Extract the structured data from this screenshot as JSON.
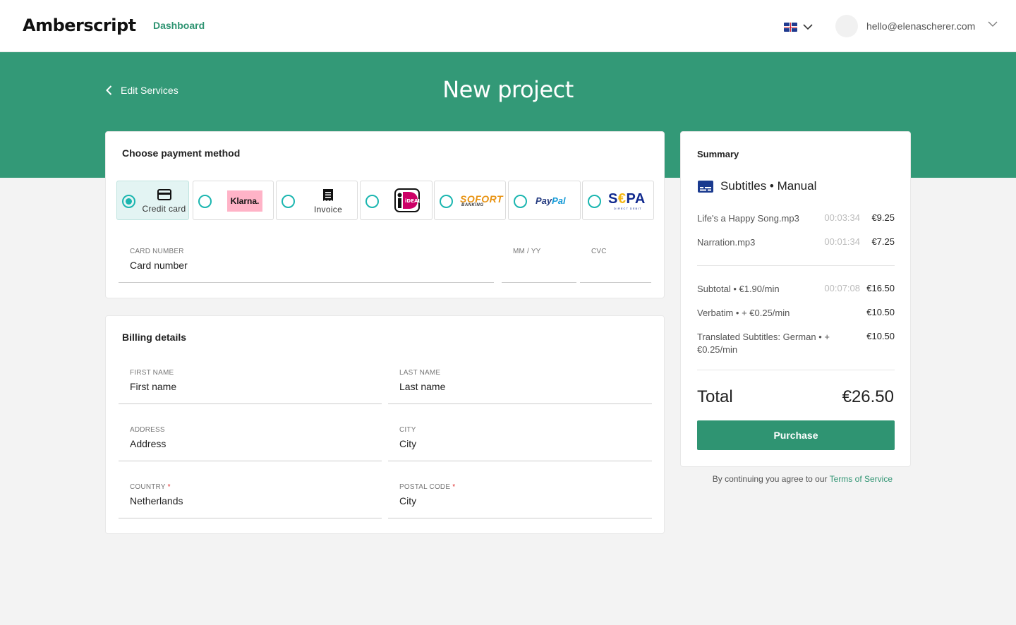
{
  "header": {
    "logo": "Amberscript",
    "nav_link": "Dashboard",
    "user_email": "hello@elenascherer.com"
  },
  "banner": {
    "back_label": "Edit Services",
    "title": "New project"
  },
  "payment": {
    "title": "Choose payment method",
    "methods": [
      {
        "id": "credit-card",
        "label": "Credit card",
        "selected": true
      },
      {
        "id": "klarna",
        "label": "Klarna.",
        "selected": false
      },
      {
        "id": "invoice",
        "label": "Invoice",
        "selected": false
      },
      {
        "id": "ideal",
        "label": "iDEAL",
        "selected": false
      },
      {
        "id": "sofort",
        "label": "SOFORT",
        "sublabel": "BANKING",
        "selected": false
      },
      {
        "id": "paypal",
        "label_a": "Pay",
        "label_b": "Pal",
        "selected": false
      },
      {
        "id": "sepa",
        "label_a": "S",
        "label_e": "€",
        "label_b": "PA",
        "sublabel": "DIRECT DEBIT",
        "selected": false
      }
    ],
    "fields": {
      "card_number": {
        "label": "CARD NUMBER",
        "placeholder": "Card number"
      },
      "expiry": {
        "label": "MM / YY",
        "placeholder": ""
      },
      "cvc": {
        "label": "CVC",
        "placeholder": ""
      }
    }
  },
  "billing": {
    "title": "Billing details",
    "fields": {
      "first_name": {
        "label": "FIRST NAME",
        "placeholder": "First name"
      },
      "last_name": {
        "label": "LAST NAME",
        "placeholder": "Last name"
      },
      "address": {
        "label": "ADDRESS",
        "placeholder": "Address"
      },
      "city": {
        "label": "CITY",
        "placeholder": "City"
      },
      "country": {
        "label": "COUNTRY",
        "value": "Netherlands",
        "required": "*"
      },
      "postal_code": {
        "label": "POSTAL CODE",
        "placeholder": "City",
        "required": "*"
      }
    }
  },
  "summary": {
    "title": "Summary",
    "service": "Subtitles • Manual",
    "files": [
      {
        "name": "Life's a Happy Song.mp3",
        "duration": "00:03:34",
        "price": "€9.25"
      },
      {
        "name": "Narration.mp3",
        "duration": "00:01:34",
        "price": "€7.25"
      }
    ],
    "lines": [
      {
        "name": "Subtotal • €1.90/min",
        "duration": "00:07:08",
        "price": "€16.50"
      },
      {
        "name": "Verbatim •  + €0.25/min",
        "duration": "",
        "price": "€10.50"
      },
      {
        "name": "Translated Subtitles: German •  + €0.25/min",
        "duration": "",
        "price": "€10.50"
      }
    ],
    "total_label": "Total",
    "total_value": "€26.50",
    "purchase_label": "Purchase",
    "terms_prefix": "By continuing you agree to our",
    "terms_link": "Terms of Service"
  },
  "colors": {
    "brand_green": "#339977",
    "button_green": "#2f9472",
    "radio_teal": "#1bb6b0"
  },
  "icons": [
    "flag-uk-icon",
    "chevron-down-icon",
    "chevron-left-icon",
    "credit-card-icon",
    "invoice-icon",
    "subtitles-icon"
  ]
}
